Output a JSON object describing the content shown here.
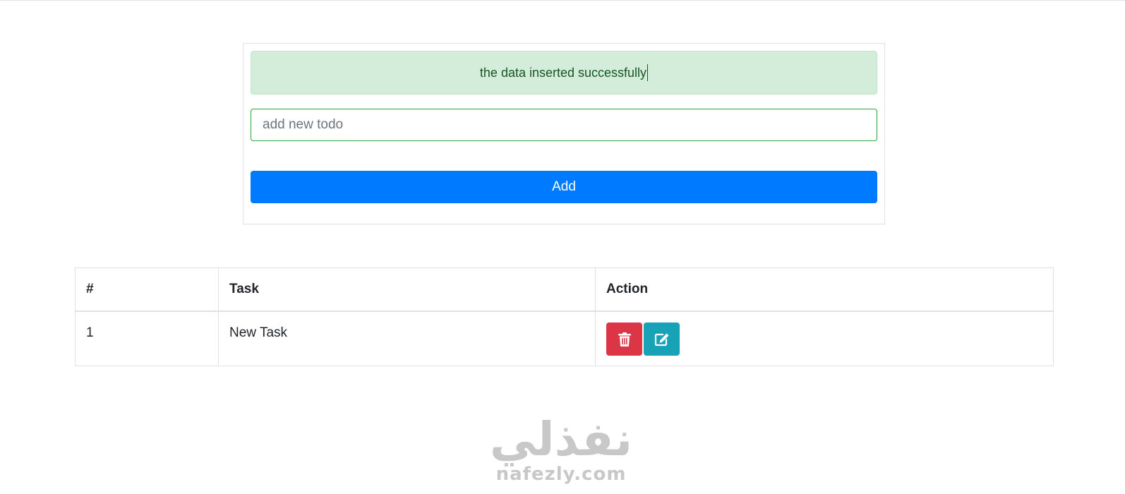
{
  "alert": {
    "message": "the data inserted successfully",
    "color": "#155724",
    "background": "#d4edda"
  },
  "todo_input": {
    "value": "",
    "placeholder": "add new todo"
  },
  "add_button": {
    "label": "Add",
    "color": "#007bff"
  },
  "table": {
    "headers": [
      "#",
      "Task",
      "Action"
    ],
    "rows": [
      {
        "num": "1",
        "task": "New Task",
        "actions": [
          {
            "icon": "trash-icon",
            "color": "#dc3545"
          },
          {
            "icon": "edit-icon",
            "color": "#17a2b8"
          }
        ]
      }
    ]
  },
  "watermark": {
    "arabic": "نفذلي",
    "latin": "nafezly.com"
  }
}
